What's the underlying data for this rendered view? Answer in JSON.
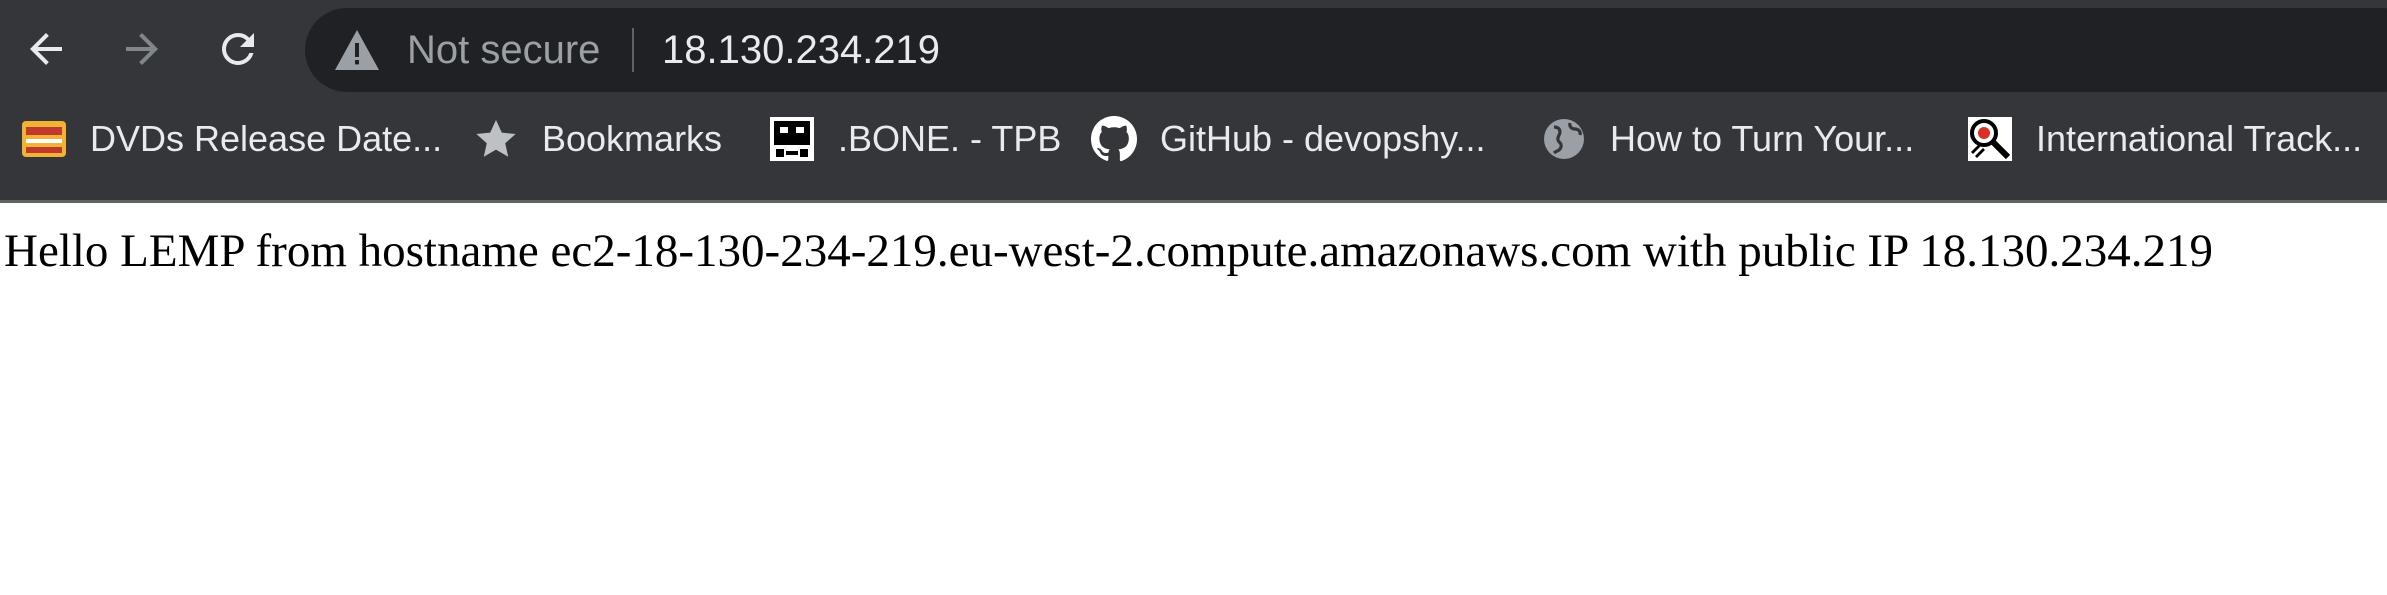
{
  "browser": {
    "nav": {
      "back_icon": "arrow-left-icon",
      "forward_icon": "arrow-right-icon",
      "reload_icon": "reload-icon"
    },
    "omnibox": {
      "security_icon": "warning-triangle-icon",
      "security_text": "Not secure",
      "url": "18.130.234.219"
    },
    "bookmarks": [
      {
        "label": "DVDs Release Date...",
        "icon": "dvd-release-favicon"
      },
      {
        "label": "Bookmarks",
        "icon": "star-icon"
      },
      {
        "label": ".BONE. - TPB",
        "icon": "tpb-favicon"
      },
      {
        "label": "GitHub - devopshy...",
        "icon": "github-icon"
      },
      {
        "label": "How to Turn Your...",
        "icon": "globe-icon"
      },
      {
        "label": "International Track...",
        "icon": "tracking-favicon"
      }
    ],
    "colors": {
      "toolbar": "#35363a",
      "omnibox": "#202124",
      "text": "#e8eaed",
      "muted": "#9aa0a6"
    }
  },
  "page": {
    "text": "Hello LEMP from hostname ec2-18-130-234-219.eu-west-2.compute.amazonaws.com with public IP 18.130.234.219"
  }
}
